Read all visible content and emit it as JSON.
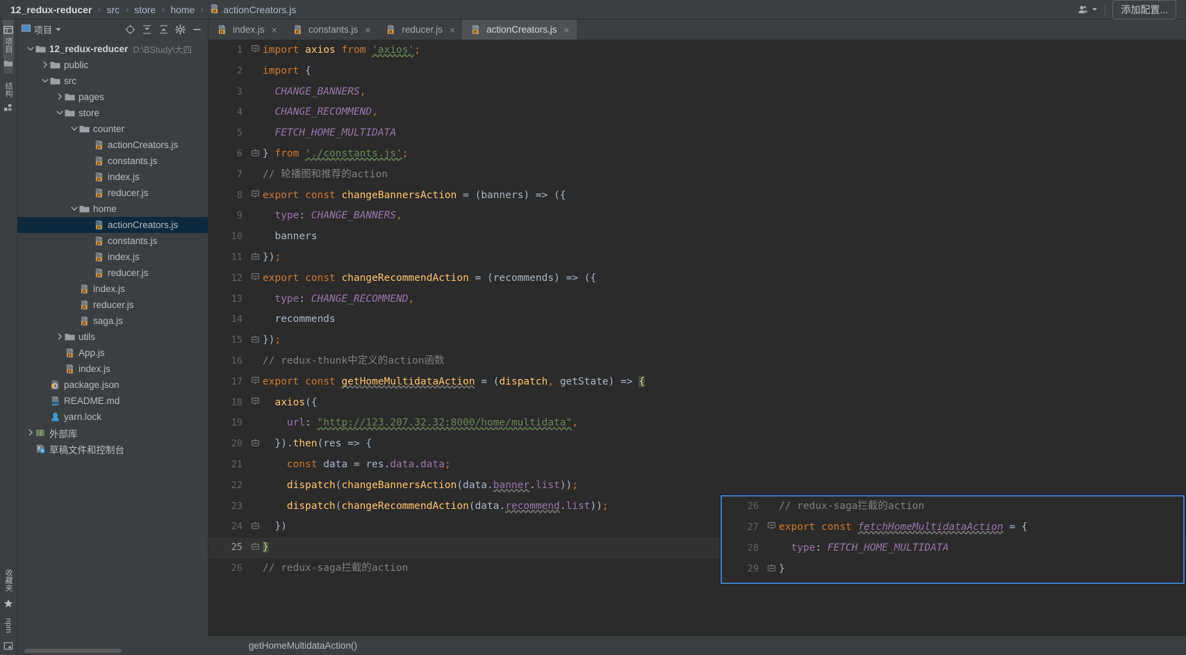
{
  "breadcrumb": {
    "items": [
      {
        "label": "12_redux-reducer",
        "icon": ""
      },
      {
        "label": "src",
        "icon": ""
      },
      {
        "label": "store",
        "icon": ""
      },
      {
        "label": "home",
        "icon": ""
      },
      {
        "label": "actionCreators.js",
        "icon": "js-file-icon"
      }
    ],
    "separator": "›"
  },
  "topbar": {
    "add_config_label": "添加配置...",
    "user_icon": "user-dropdown-icon"
  },
  "vstrip": {
    "top": [
      {
        "label": "项目",
        "icon": "project-icon"
      },
      {
        "label": "",
        "icon": "folder-icon"
      },
      {
        "label": "结构",
        "icon": "structure-icon"
      },
      {
        "label": "",
        "icon": "modules-icon"
      }
    ],
    "bottom": [
      {
        "label": "收藏夹",
        "icon": "star-icon"
      },
      {
        "label": "npm",
        "icon": "npm-icon"
      },
      {
        "label": "",
        "icon": "terminal-icon"
      }
    ]
  },
  "panel": {
    "title": "项目",
    "title_icon": "project-panel-icon",
    "dropdown_icon": "chevron-down-icon",
    "toolbar_icons": [
      "locate-icon",
      "expand-all-icon",
      "collapse-all-icon",
      "settings-gear-icon",
      "hide-icon"
    ],
    "tree": [
      {
        "depth": 0,
        "arrow": "down",
        "icon": "folder-icon",
        "label": "12_redux-reducer",
        "bold": true,
        "path": "D:\\BStudy\\大四",
        "selected": false
      },
      {
        "depth": 1,
        "arrow": "right",
        "icon": "folder-icon",
        "label": "public",
        "selected": false
      },
      {
        "depth": 1,
        "arrow": "down",
        "icon": "folder-icon",
        "label": "src",
        "selected": false
      },
      {
        "depth": 2,
        "arrow": "right",
        "icon": "folder-icon",
        "label": "pages",
        "selected": false
      },
      {
        "depth": 2,
        "arrow": "down",
        "icon": "folder-icon",
        "label": "store",
        "selected": false
      },
      {
        "depth": 3,
        "arrow": "down",
        "icon": "folder-icon",
        "label": "counter",
        "selected": false
      },
      {
        "depth": 4,
        "arrow": "none",
        "icon": "js-file-icon",
        "label": "actionCreators.js",
        "selected": false
      },
      {
        "depth": 4,
        "arrow": "none",
        "icon": "js-file-icon",
        "label": "constants.js",
        "selected": false
      },
      {
        "depth": 4,
        "arrow": "none",
        "icon": "js-file-icon",
        "label": "index.js",
        "selected": false
      },
      {
        "depth": 4,
        "arrow": "none",
        "icon": "js-file-icon",
        "label": "reducer.js",
        "selected": false
      },
      {
        "depth": 3,
        "arrow": "down",
        "icon": "folder-icon",
        "label": "home",
        "selected": false
      },
      {
        "depth": 4,
        "arrow": "none",
        "icon": "js-file-icon",
        "label": "actionCreators.js",
        "selected": true
      },
      {
        "depth": 4,
        "arrow": "none",
        "icon": "js-file-icon",
        "label": "constants.js",
        "selected": false
      },
      {
        "depth": 4,
        "arrow": "none",
        "icon": "js-file-icon",
        "label": "index.js",
        "selected": false
      },
      {
        "depth": 4,
        "arrow": "none",
        "icon": "js-file-icon",
        "label": "reducer.js",
        "selected": false
      },
      {
        "depth": 3,
        "arrow": "none",
        "icon": "js-file-icon",
        "label": "index.js",
        "selected": false
      },
      {
        "depth": 3,
        "arrow": "none",
        "icon": "js-file-icon",
        "label": "reducer.js",
        "selected": false
      },
      {
        "depth": 3,
        "arrow": "none",
        "icon": "js-file-icon",
        "label": "saga.js",
        "selected": false
      },
      {
        "depth": 2,
        "arrow": "right",
        "icon": "folder-icon",
        "label": "utils",
        "selected": false
      },
      {
        "depth": 2,
        "arrow": "none",
        "icon": "js-file-icon",
        "label": "App.js",
        "selected": false
      },
      {
        "depth": 2,
        "arrow": "none",
        "icon": "js-file-icon",
        "label": "index.js",
        "selected": false
      },
      {
        "depth": 1,
        "arrow": "none",
        "icon": "json-file-icon",
        "label": "package.json",
        "selected": false
      },
      {
        "depth": 1,
        "arrow": "none",
        "icon": "md-file-icon",
        "label": "README.md",
        "selected": false
      },
      {
        "depth": 1,
        "arrow": "none",
        "icon": "yarn-icon",
        "label": "yarn.lock",
        "selected": false
      },
      {
        "depth": 0,
        "arrow": "right",
        "icon": "library-icon",
        "label": "外部库",
        "selected": false
      },
      {
        "depth": 0,
        "arrow": "none",
        "icon": "scratch-icon",
        "label": "草稿文件和控制台",
        "selected": false
      }
    ]
  },
  "tabs": [
    {
      "label": "index.js",
      "icon": "js-file-icon",
      "active": false,
      "close": "×"
    },
    {
      "label": "constants.js",
      "icon": "js-file-icon",
      "active": false,
      "close": "×"
    },
    {
      "label": "reducer.js",
      "icon": "js-file-icon",
      "active": false,
      "close": "×"
    },
    {
      "label": "actionCreators.js",
      "icon": "js-file-icon",
      "active": true,
      "close": "×"
    }
  ],
  "editor": {
    "lines": [
      {
        "n": "1",
        "fold": "minus-open",
        "current": false
      },
      {
        "n": "2",
        "fold": "",
        "current": false
      },
      {
        "n": "3",
        "fold": "",
        "current": false
      },
      {
        "n": "4",
        "fold": "",
        "current": false
      },
      {
        "n": "5",
        "fold": "",
        "current": false
      },
      {
        "n": "6",
        "fold": "minus-close",
        "current": false
      },
      {
        "n": "7",
        "fold": "",
        "current": false
      },
      {
        "n": "8",
        "fold": "minus-open",
        "current": false
      },
      {
        "n": "9",
        "fold": "",
        "current": false
      },
      {
        "n": "10",
        "fold": "",
        "current": false
      },
      {
        "n": "11",
        "fold": "minus-close",
        "current": false
      },
      {
        "n": "12",
        "fold": "minus-open",
        "current": false
      },
      {
        "n": "13",
        "fold": "",
        "current": false
      },
      {
        "n": "14",
        "fold": "",
        "current": false
      },
      {
        "n": "15",
        "fold": "minus-close",
        "current": false
      },
      {
        "n": "16",
        "fold": "",
        "current": false
      },
      {
        "n": "17",
        "fold": "minus-open",
        "current": false
      },
      {
        "n": "18",
        "fold": "minus-open",
        "current": false
      },
      {
        "n": "19",
        "fold": "",
        "current": false
      },
      {
        "n": "20",
        "fold": "minus-close",
        "current": false
      },
      {
        "n": "21",
        "fold": "",
        "current": false
      },
      {
        "n": "22",
        "fold": "",
        "current": false
      },
      {
        "n": "23",
        "fold": "",
        "current": false
      },
      {
        "n": "24",
        "fold": "minus-close",
        "current": false
      },
      {
        "n": "25",
        "fold": "minus-close",
        "current": true
      },
      {
        "n": "26",
        "fold": "",
        "current": false
      }
    ],
    "code_text": [
      "import axios from 'axios';",
      "import {",
      "  CHANGE_BANNERS,",
      "  CHANGE_RECOMMEND,",
      "  FETCH_HOME_MULTIDATA",
      "} from './constants.js';",
      "// 轮播图和推荐的action",
      "export const changeBannersAction = (banners) => ({",
      "  type: CHANGE_BANNERS,",
      "  banners",
      "});",
      "export const changeRecommendAction = (recommends) => ({",
      "  type: CHANGE_RECOMMEND,",
      "  recommends",
      "});",
      "// redux-thunk中定义的action函数",
      "export const getHomeMultidataAction = (dispatch, getState) => {",
      "  axios({",
      "    url: \"http://123.207.32.32:8000/home/multidata\",",
      "  }).then(res => {",
      "    const data = res.data.data;",
      "    dispatch(changeBannersAction(data.banner.list));",
      "    dispatch(changeRecommendAction(data.recommend.list));",
      "  })",
      "}",
      "// redux-saga拦截的action"
    ],
    "url_value": "http://123.207.32.32:8000/home/multidata"
  },
  "popup": {
    "lines": [
      {
        "n": "26",
        "fold": "",
        "current": false
      },
      {
        "n": "27",
        "fold": "minus-open",
        "current": false
      },
      {
        "n": "28",
        "fold": "",
        "current": false
      },
      {
        "n": "29",
        "fold": "minus-close",
        "current": false
      }
    ],
    "code_text": [
      "// redux-saga拦截的action",
      "export const fetchHomeMultidataAction = {",
      "  type: FETCH_HOME_MULTIDATA",
      "}"
    ],
    "border_color": "#3d7fc1"
  },
  "footer": {
    "status_text": "getHomeMultidataAction()"
  },
  "colors": {
    "bg_editor": "#2b2b2b",
    "bg_chrome": "#3c3f41",
    "selection": "#0d293e",
    "keyword": "#cc7832",
    "function": "#ffc66d",
    "string": "#6a8759",
    "comment": "#808080",
    "constant": "#9876aa",
    "plain": "#a9b7c6",
    "tab_active": "#4e5254",
    "current_line": "#323232"
  }
}
